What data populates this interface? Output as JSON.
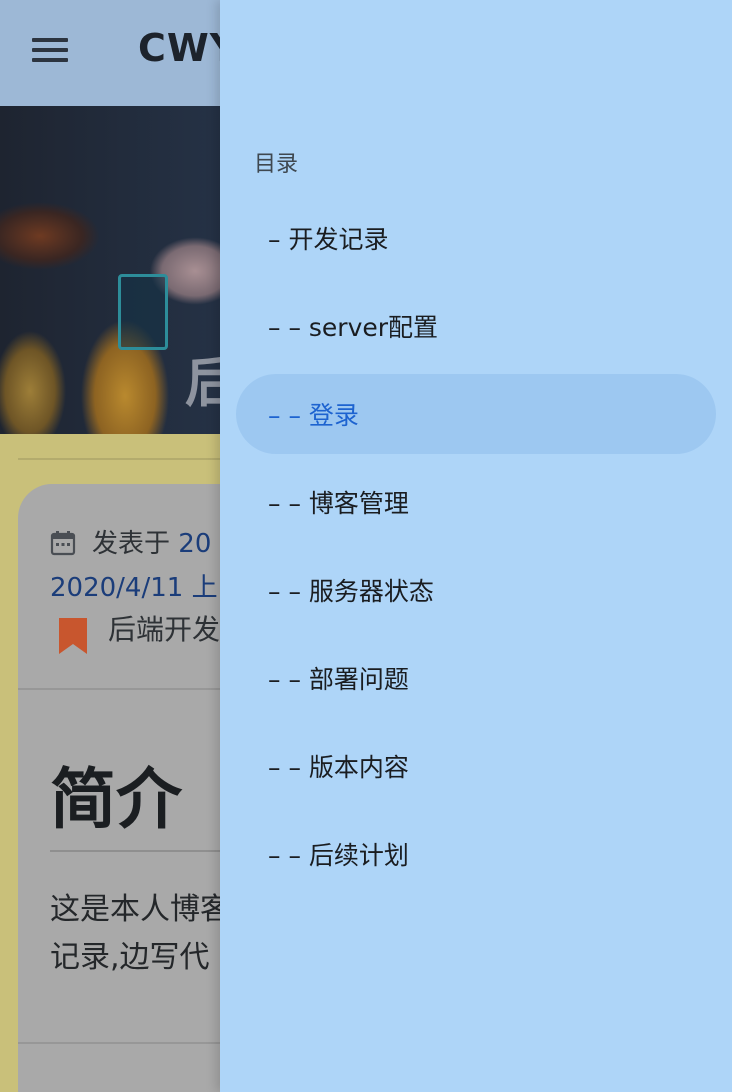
{
  "appbar": {
    "title": "CWY"
  },
  "hero": {
    "title": "后"
  },
  "post": {
    "published_label": "发表于",
    "published_date_partial": "20",
    "published_date_line2": "2020/4/11 上",
    "category": "后端开发"
  },
  "content": {
    "section_heading": "简介",
    "intro_lines": [
      "这是本人博客",
      "记录,边写代"
    ]
  },
  "drawer": {
    "header": "目录",
    "items": [
      {
        "label": "– 开发记录"
      },
      {
        "label": "– – server配置"
      },
      {
        "label": "– – 登录"
      },
      {
        "label": "– – 博客管理"
      },
      {
        "label": "– – 服务器状态"
      },
      {
        "label": "– – 部署问题"
      },
      {
        "label": "– – 版本内容"
      },
      {
        "label": "– – 后续计划"
      }
    ],
    "active_index": 2
  },
  "colors": {
    "drawer_bg": "#aed5f8",
    "active_item_bg": "#9dc8f1",
    "active_item_text": "#1d63d0",
    "link_text": "#1b3d7a",
    "bookmark": "#c8562e"
  },
  "icons": {
    "menu": "menu-icon",
    "calendar": "calendar-icon",
    "bookmark": "bookmark-icon"
  }
}
